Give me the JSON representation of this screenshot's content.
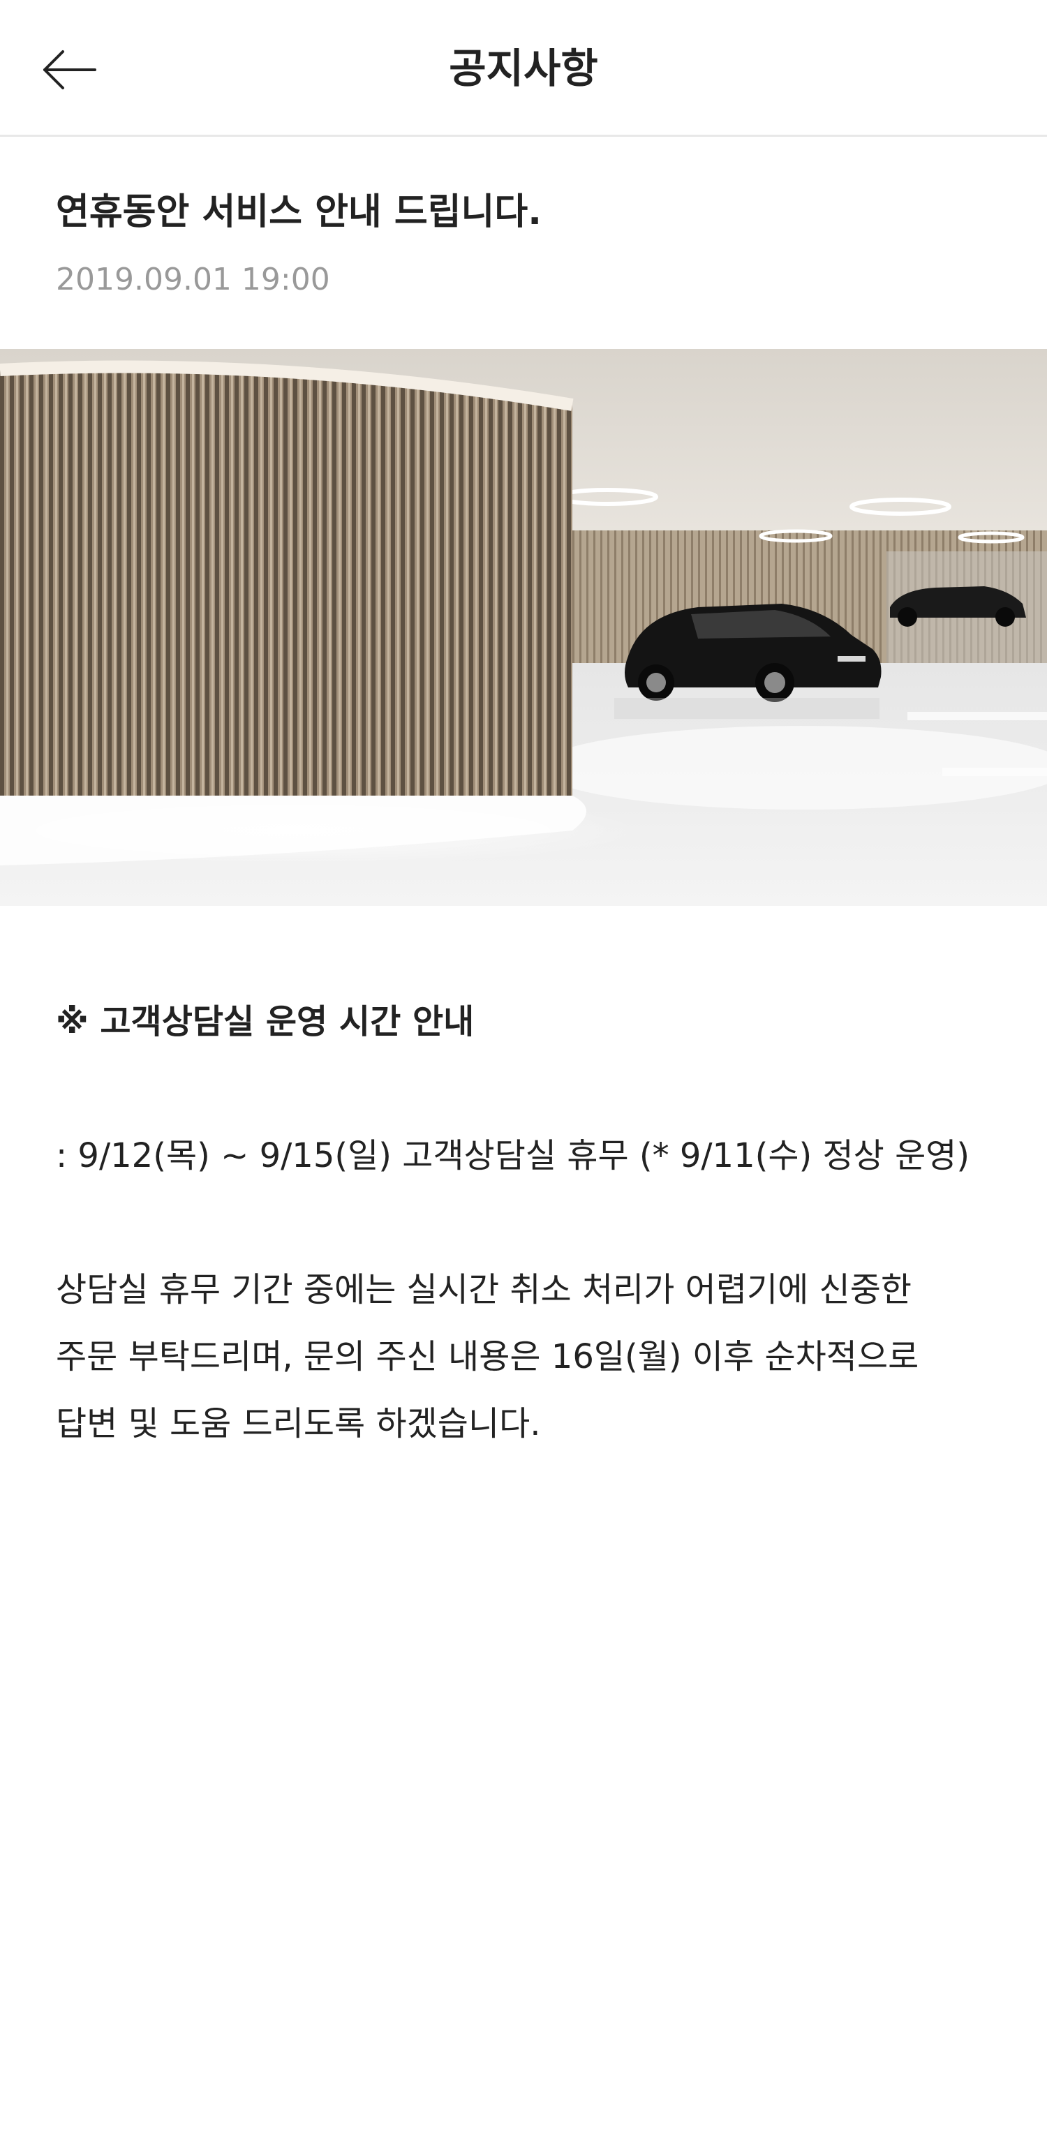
{
  "header": {
    "title": "공지사항",
    "back_icon": "arrow-left-icon"
  },
  "notice": {
    "title": "연휴동안 서비스 안내 드립니다.",
    "date": "2019.09.01 19:00"
  },
  "hero_image": {
    "subject": "car-showroom-photo"
  },
  "body": {
    "heading": "※ 고객상담실 운영 시간 안내",
    "schedule": ": 9/12(목) ~ 9/15(일) 고객상담실 휴무 (* 9/11(수) 정상 운영)",
    "lines": [
      "상담실 휴무 기간 중에는 실시간 취소 처리가 어렵기에 신중한",
      "주문 부탁드리며, 문의 주신 내용은 16일(월) 이후 순차적으로",
      "답변 및 도움 드리도록 하겠습니다."
    ]
  },
  "colors": {
    "text": "#222222",
    "date": "#999999",
    "divider": "#e8e8e8",
    "background": "#ffffff"
  }
}
